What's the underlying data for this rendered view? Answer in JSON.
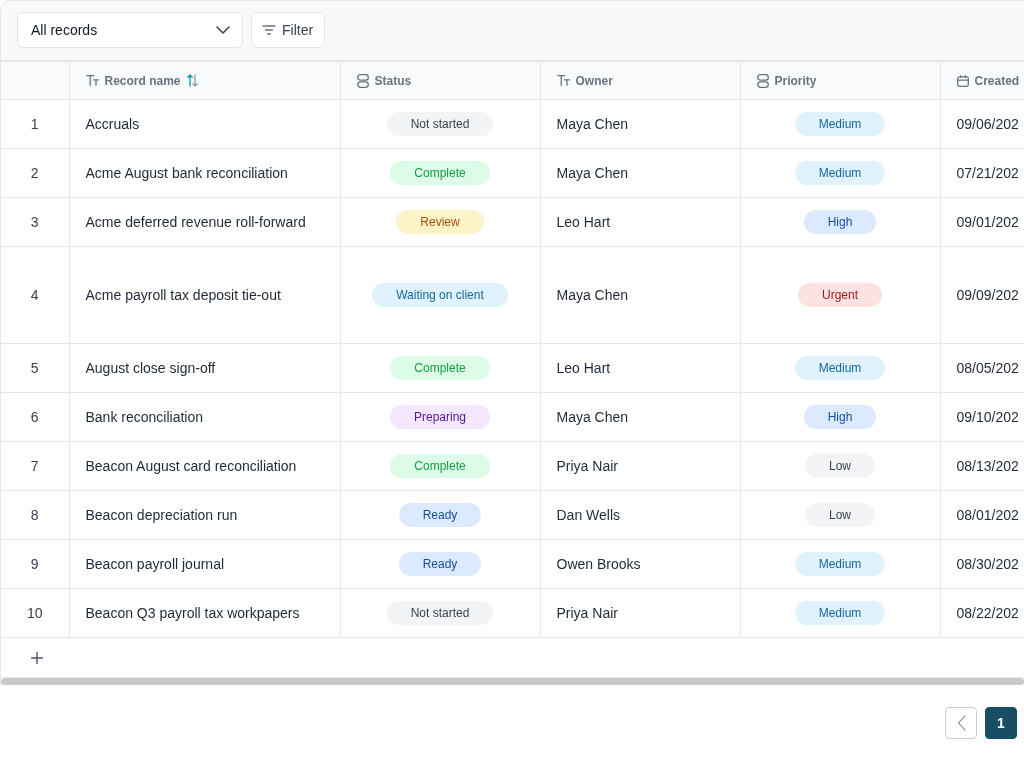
{
  "toolbar": {
    "view_select": {
      "value": "All records"
    },
    "filter_button": {
      "label": "Filter"
    }
  },
  "table": {
    "columns": [
      {
        "label": "Record name",
        "kind": "text",
        "sorted": true
      },
      {
        "label": "Status",
        "kind": "select",
        "sorted": false
      },
      {
        "label": "Owner",
        "kind": "text",
        "sorted": false
      },
      {
        "label": "Priority",
        "kind": "select",
        "sorted": false
      },
      {
        "label": "Created",
        "kind": "date",
        "sorted": false
      }
    ],
    "rows": [
      {
        "number": "1",
        "record_name": "Accruals",
        "status": {
          "label": "Not started",
          "color": "#f3f4f6"
        },
        "owner": "Maya Chen",
        "priority": {
          "label": "Medium",
          "color": "#e0f2fe"
        },
        "created": "09/06/202"
      },
      {
        "number": "2",
        "record_name": "Acme August bank reconciliation",
        "status": {
          "label": "Complete",
          "color": "#dcfce7"
        },
        "owner": "Maya Chen",
        "priority": {
          "label": "Medium",
          "color": "#e0f2fe"
        },
        "created": "07/21/202"
      },
      {
        "number": "3",
        "record_name": "Acme deferred revenue roll-forward",
        "status": {
          "label": "Review",
          "color": "#fef3c7"
        },
        "owner": "Leo Hart",
        "priority": {
          "label": "High",
          "color": "#dbeafe"
        },
        "created": "09/01/202"
      },
      {
        "number": "4",
        "record_name": "Acme payroll tax deposit tie-out",
        "status": {
          "label": "Waiting on client",
          "color": "#e0f2fe"
        },
        "owner": "Maya Chen",
        "priority": {
          "label": "Urgent",
          "color": "#fee2e2"
        },
        "created": "09/09/202"
      },
      {
        "number": "5",
        "record_name": "August close sign-off",
        "status": {
          "label": "Complete",
          "color": "#dcfce7"
        },
        "owner": "Leo Hart",
        "priority": {
          "label": "Medium",
          "color": "#e0f2fe"
        },
        "created": "08/05/202"
      },
      {
        "number": "6",
        "record_name": "Bank reconciliation",
        "status": {
          "label": "Preparing",
          "color": "#f3e8ff"
        },
        "owner": "Maya Chen",
        "priority": {
          "label": "High",
          "color": "#dbeafe"
        },
        "created": "09/10/202"
      },
      {
        "number": "7",
        "record_name": "Beacon August card reconciliation",
        "status": {
          "label": "Complete",
          "color": "#dcfce7"
        },
        "owner": "Priya Nair",
        "priority": {
          "label": "Low",
          "color": "#f3f4f6"
        },
        "created": "08/13/202"
      },
      {
        "number": "8",
        "record_name": "Beacon depreciation run",
        "status": {
          "label": "Ready",
          "color": "#dbeafe"
        },
        "owner": "Dan Wells",
        "priority": {
          "label": "Low",
          "color": "#f3f4f6"
        },
        "created": "08/01/202"
      },
      {
        "number": "9",
        "record_name": "Beacon payroll journal",
        "status": {
          "label": "Ready",
          "color": "#dbeafe"
        },
        "owner": "Owen Brooks",
        "priority": {
          "label": "Medium",
          "color": "#e0f2fe"
        },
        "created": "08/30/202"
      },
      {
        "number": "10",
        "record_name": "Beacon Q3 payroll tax workpapers",
        "status": {
          "label": "Not started",
          "color": "#f3f4f6"
        },
        "owner": "Priya Nair",
        "priority": {
          "label": "Medium",
          "color": "#e0f2fe"
        },
        "created": "08/22/202"
      }
    ]
  },
  "pagination": {
    "previous": {
      "disabled": true
    },
    "pages": [
      {
        "label": "1",
        "selected": true
      }
    ]
  }
}
